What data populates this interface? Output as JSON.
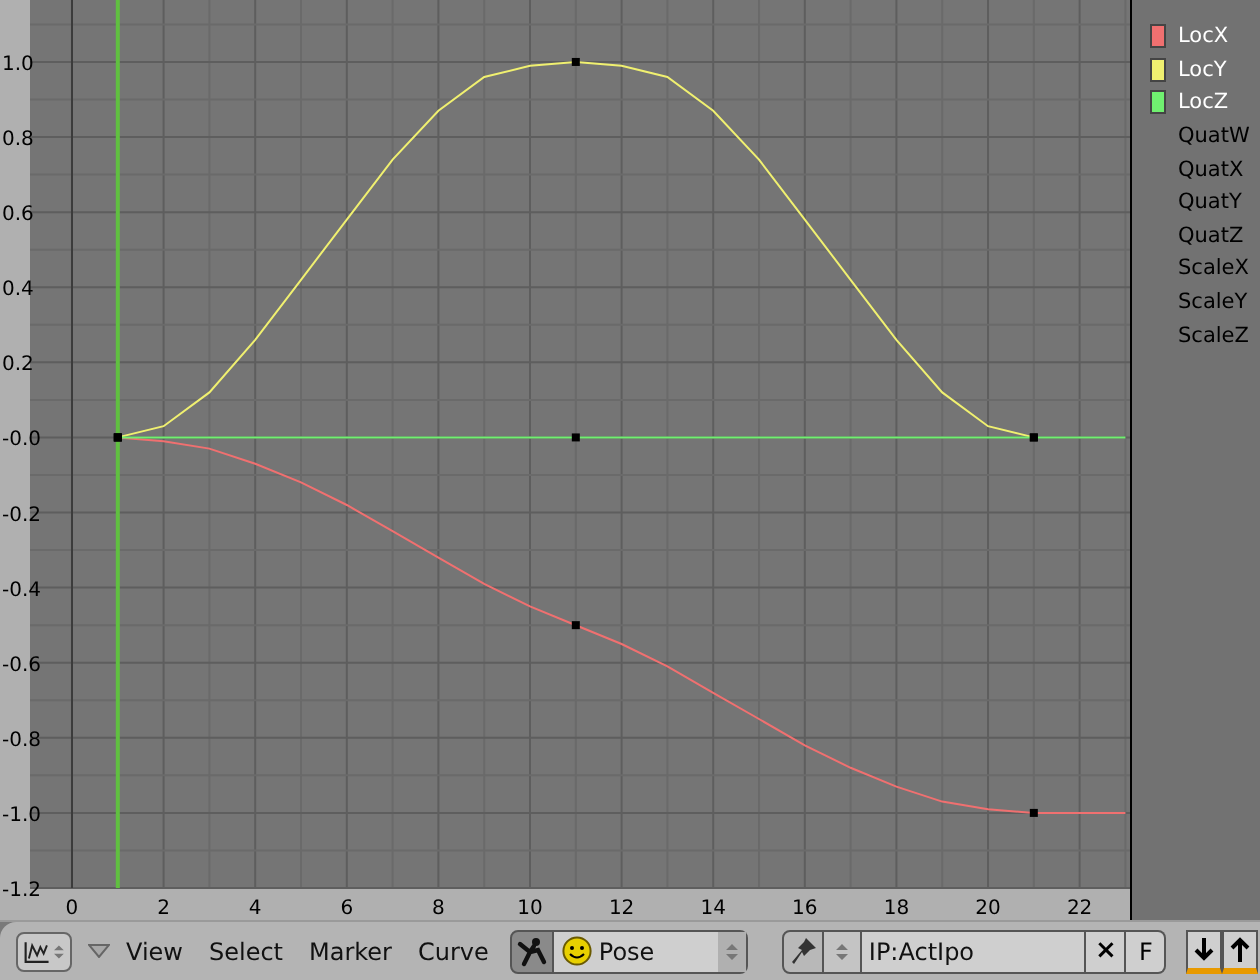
{
  "ipo_editor": {
    "chart_data": {
      "type": "line",
      "x": [
        1,
        2,
        3,
        4,
        5,
        6,
        7,
        8,
        9,
        10,
        11,
        12,
        13,
        14,
        15,
        16,
        17,
        18,
        19,
        20,
        21,
        22,
        23
      ],
      "xlim": [
        -0.917,
        23.1
      ],
      "ylim": [
        -1.2,
        1.165
      ],
      "grid": true,
      "xticks": [
        0,
        2,
        4,
        6,
        8,
        10,
        12,
        14,
        16,
        18,
        20,
        22
      ],
      "yticks": [
        {
          "value": 1.0,
          "label": "1.0"
        },
        {
          "value": 0.8,
          "label": "0.8"
        },
        {
          "value": 0.6,
          "label": "0.6"
        },
        {
          "value": 0.4,
          "label": "0.4"
        },
        {
          "value": 0.2,
          "label": "0.2"
        },
        {
          "value": 0,
          "label": "-0.0"
        },
        {
          "value": -0.2,
          "label": "-0.2"
        },
        {
          "value": -0.4,
          "label": "-0.4"
        },
        {
          "value": -0.6,
          "label": "-0.6"
        },
        {
          "value": -0.8,
          "label": "-0.8"
        },
        {
          "value": -1.0,
          "label": "-1.0"
        },
        {
          "value": -1.2,
          "label": "-1.2"
        }
      ],
      "series": [
        {
          "name": "LocX",
          "color": "#f07070",
          "values": [
            0,
            -0.01,
            -0.03,
            -0.07,
            -0.12,
            -0.18,
            -0.25,
            -0.32,
            -0.39,
            -0.45,
            -0.5,
            -0.55,
            -0.61,
            -0.68,
            -0.75,
            -0.82,
            -0.88,
            -0.93,
            -0.97,
            -0.99,
            -1.0,
            -1.0,
            -1.0
          ]
        },
        {
          "name": "LocY",
          "color": "#f0f070",
          "values": [
            0,
            0.03,
            0.12,
            0.26,
            0.42,
            0.58,
            0.74,
            0.87,
            0.96,
            0.99,
            1.0,
            0.99,
            0.96,
            0.87,
            0.74,
            0.58,
            0.42,
            0.26,
            0.12,
            0.03,
            0,
            null,
            null
          ]
        },
        {
          "name": "LocZ",
          "color": "#70f070",
          "values": [
            0,
            0,
            0,
            0,
            0,
            0,
            0,
            0,
            0,
            0,
            0,
            0,
            0,
            0,
            0,
            0,
            0,
            0,
            0,
            0,
            0,
            0,
            0
          ]
        }
      ],
      "ref_lines": [
        {
          "axis": "x",
          "value": 1,
          "color": "#60c040"
        }
      ]
    },
    "empty_channels": [
      "QuatW",
      "QuatX",
      "QuatY",
      "QuatZ",
      "ScaleX",
      "ScaleY",
      "ScaleZ"
    ]
  },
  "header": {
    "menus": [
      "View",
      "Select",
      "Marker",
      "Curve"
    ],
    "pose_toggle": {
      "on": true
    },
    "mode_dropdown": {
      "value": "Pose"
    },
    "ipo_field": {
      "value": "IP:ActIpo"
    },
    "clear_button": "×",
    "fake_user_button": "F"
  }
}
